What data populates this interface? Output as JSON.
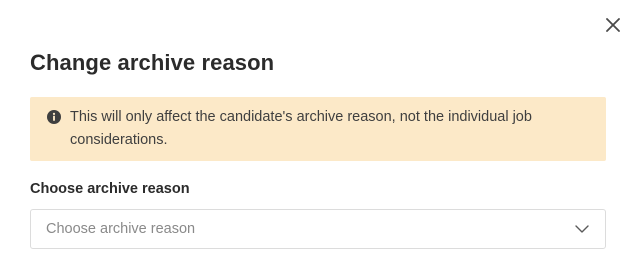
{
  "dialog": {
    "title": "Change archive reason",
    "close_icon": "close-icon"
  },
  "warning": {
    "icon": "info-icon",
    "text": "This will only affect the candidate's archive reason, not the individual job considerations.",
    "background_color": "#fce9c8"
  },
  "archive_reason": {
    "label": "Choose archive reason",
    "placeholder": "Choose archive reason",
    "dropdown_icon": "chevron-down-icon"
  }
}
